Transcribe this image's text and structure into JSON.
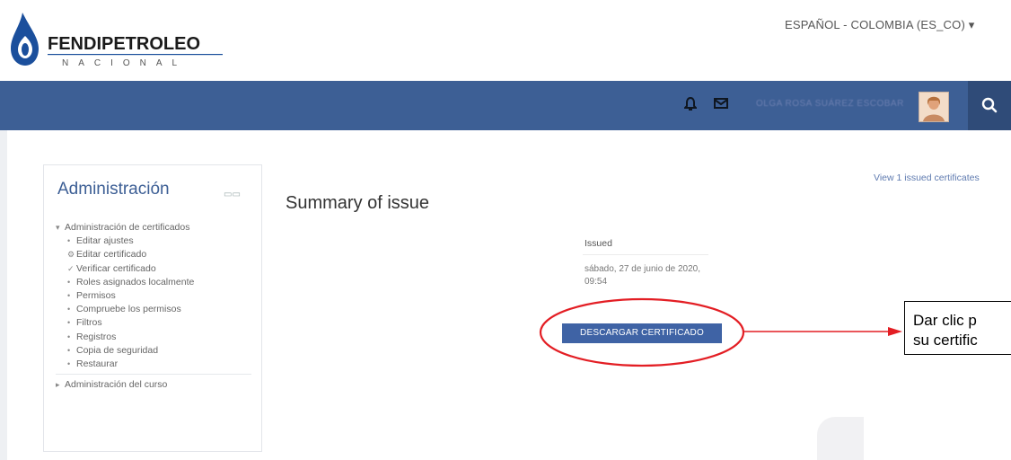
{
  "header": {
    "brand_name": "FENDIPETROLEO",
    "brand_tagline": "NACIONAL",
    "language": "ESPAÑOL - COLOMBIA (ES_CO) ▾"
  },
  "navbar": {
    "user_name": "OLGA ROSA SUÁREZ ESCOBAR",
    "notification_icon": "bell-icon",
    "message_icon": "envelope-icon",
    "search_icon": "search-icon"
  },
  "sidebar": {
    "title": "Administración",
    "section1": "Administración de certificados",
    "items": [
      {
        "icon": "bullet",
        "label": "Editar ajustes"
      },
      {
        "icon": "gear-icon",
        "label": "Editar certificado"
      },
      {
        "icon": "check-icon",
        "label": "Verificar certificado"
      },
      {
        "icon": "bullet",
        "label": "Roles asignados localmente"
      },
      {
        "icon": "bullet",
        "label": "Permisos"
      },
      {
        "icon": "bullet",
        "label": "Compruebe los permisos"
      },
      {
        "icon": "bullet",
        "label": "Filtros"
      },
      {
        "icon": "bullet",
        "label": "Registros"
      },
      {
        "icon": "bullet",
        "label": "Copia de seguridad"
      },
      {
        "icon": "bullet",
        "label": "Restaurar"
      }
    ],
    "section2": "Administración del curso"
  },
  "main": {
    "view_link": "View 1 issued certificates",
    "title": "Summary of issue",
    "issued_label": "Issued",
    "issued_date": "sábado, 27 de junio de 2020, 09:54",
    "download_button": "DESCARGAR CERTIFICADO"
  },
  "annotation": {
    "callout_line1": "Dar clic p",
    "callout_line2": "su certific",
    "color": "#e31e24"
  }
}
